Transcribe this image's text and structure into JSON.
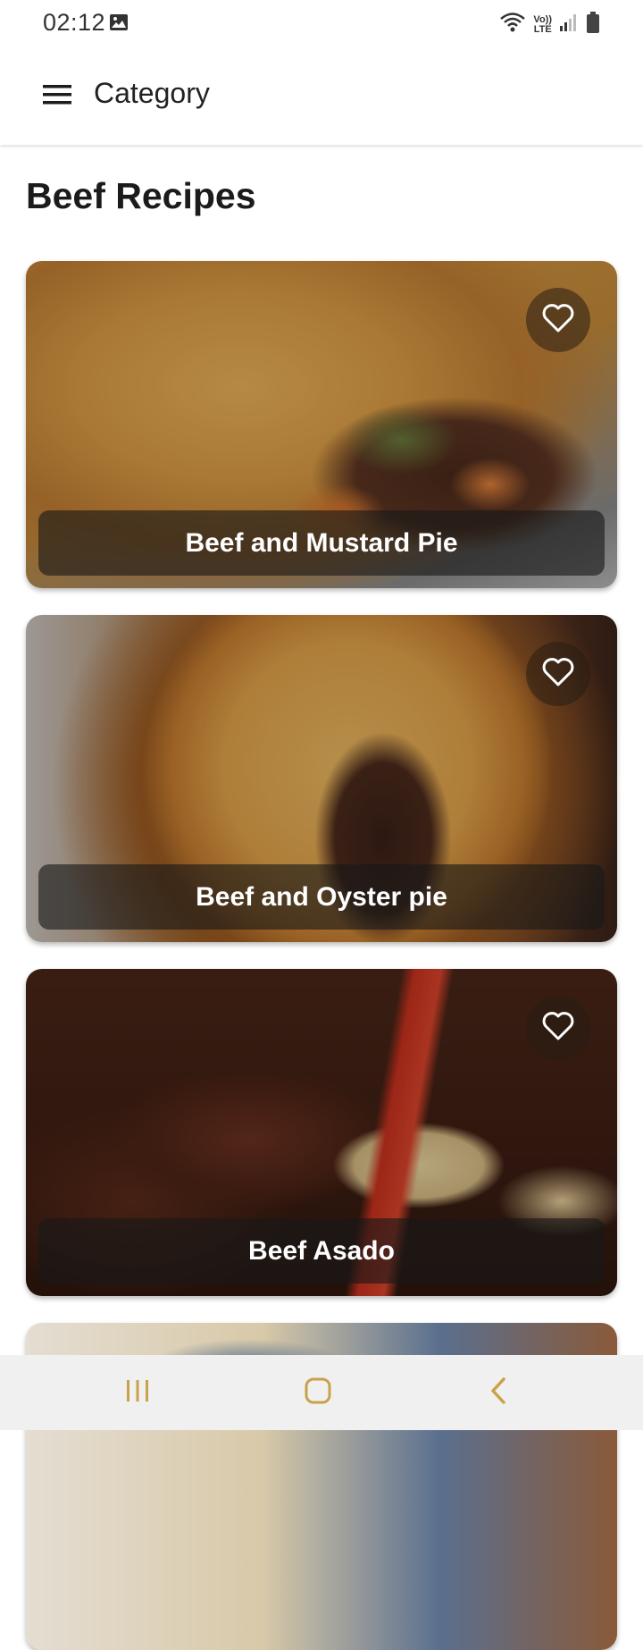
{
  "status_bar": {
    "time": "02:12",
    "left_icon": "image-icon",
    "right_icons": [
      "wifi-icon",
      "volte-icon",
      "signal-icon",
      "battery-icon"
    ],
    "volte_line1": "Vo))",
    "volte_line2": "LTE"
  },
  "app_bar": {
    "menu_icon": "hamburger-menu-icon",
    "title": "Category"
  },
  "page": {
    "title": "Beef Recipes"
  },
  "recipes": [
    {
      "name": "Beef and Mustard Pie",
      "favorite_icon": "heart-outline-icon",
      "favorited": false
    },
    {
      "name": "Beef and Oyster pie",
      "favorite_icon": "heart-outline-icon",
      "favorited": false
    },
    {
      "name": "Beef Asado",
      "favorite_icon": "heart-outline-icon",
      "favorited": false
    },
    {
      "name": "",
      "favorite_icon": "",
      "favorited": false
    }
  ],
  "nav_bar": {
    "buttons": [
      "recent-apps-icon",
      "home-icon",
      "back-icon"
    ]
  },
  "colors": {
    "nav_icon": "#c8a24a",
    "background": "#ffffff",
    "label_overlay": "#191919"
  }
}
